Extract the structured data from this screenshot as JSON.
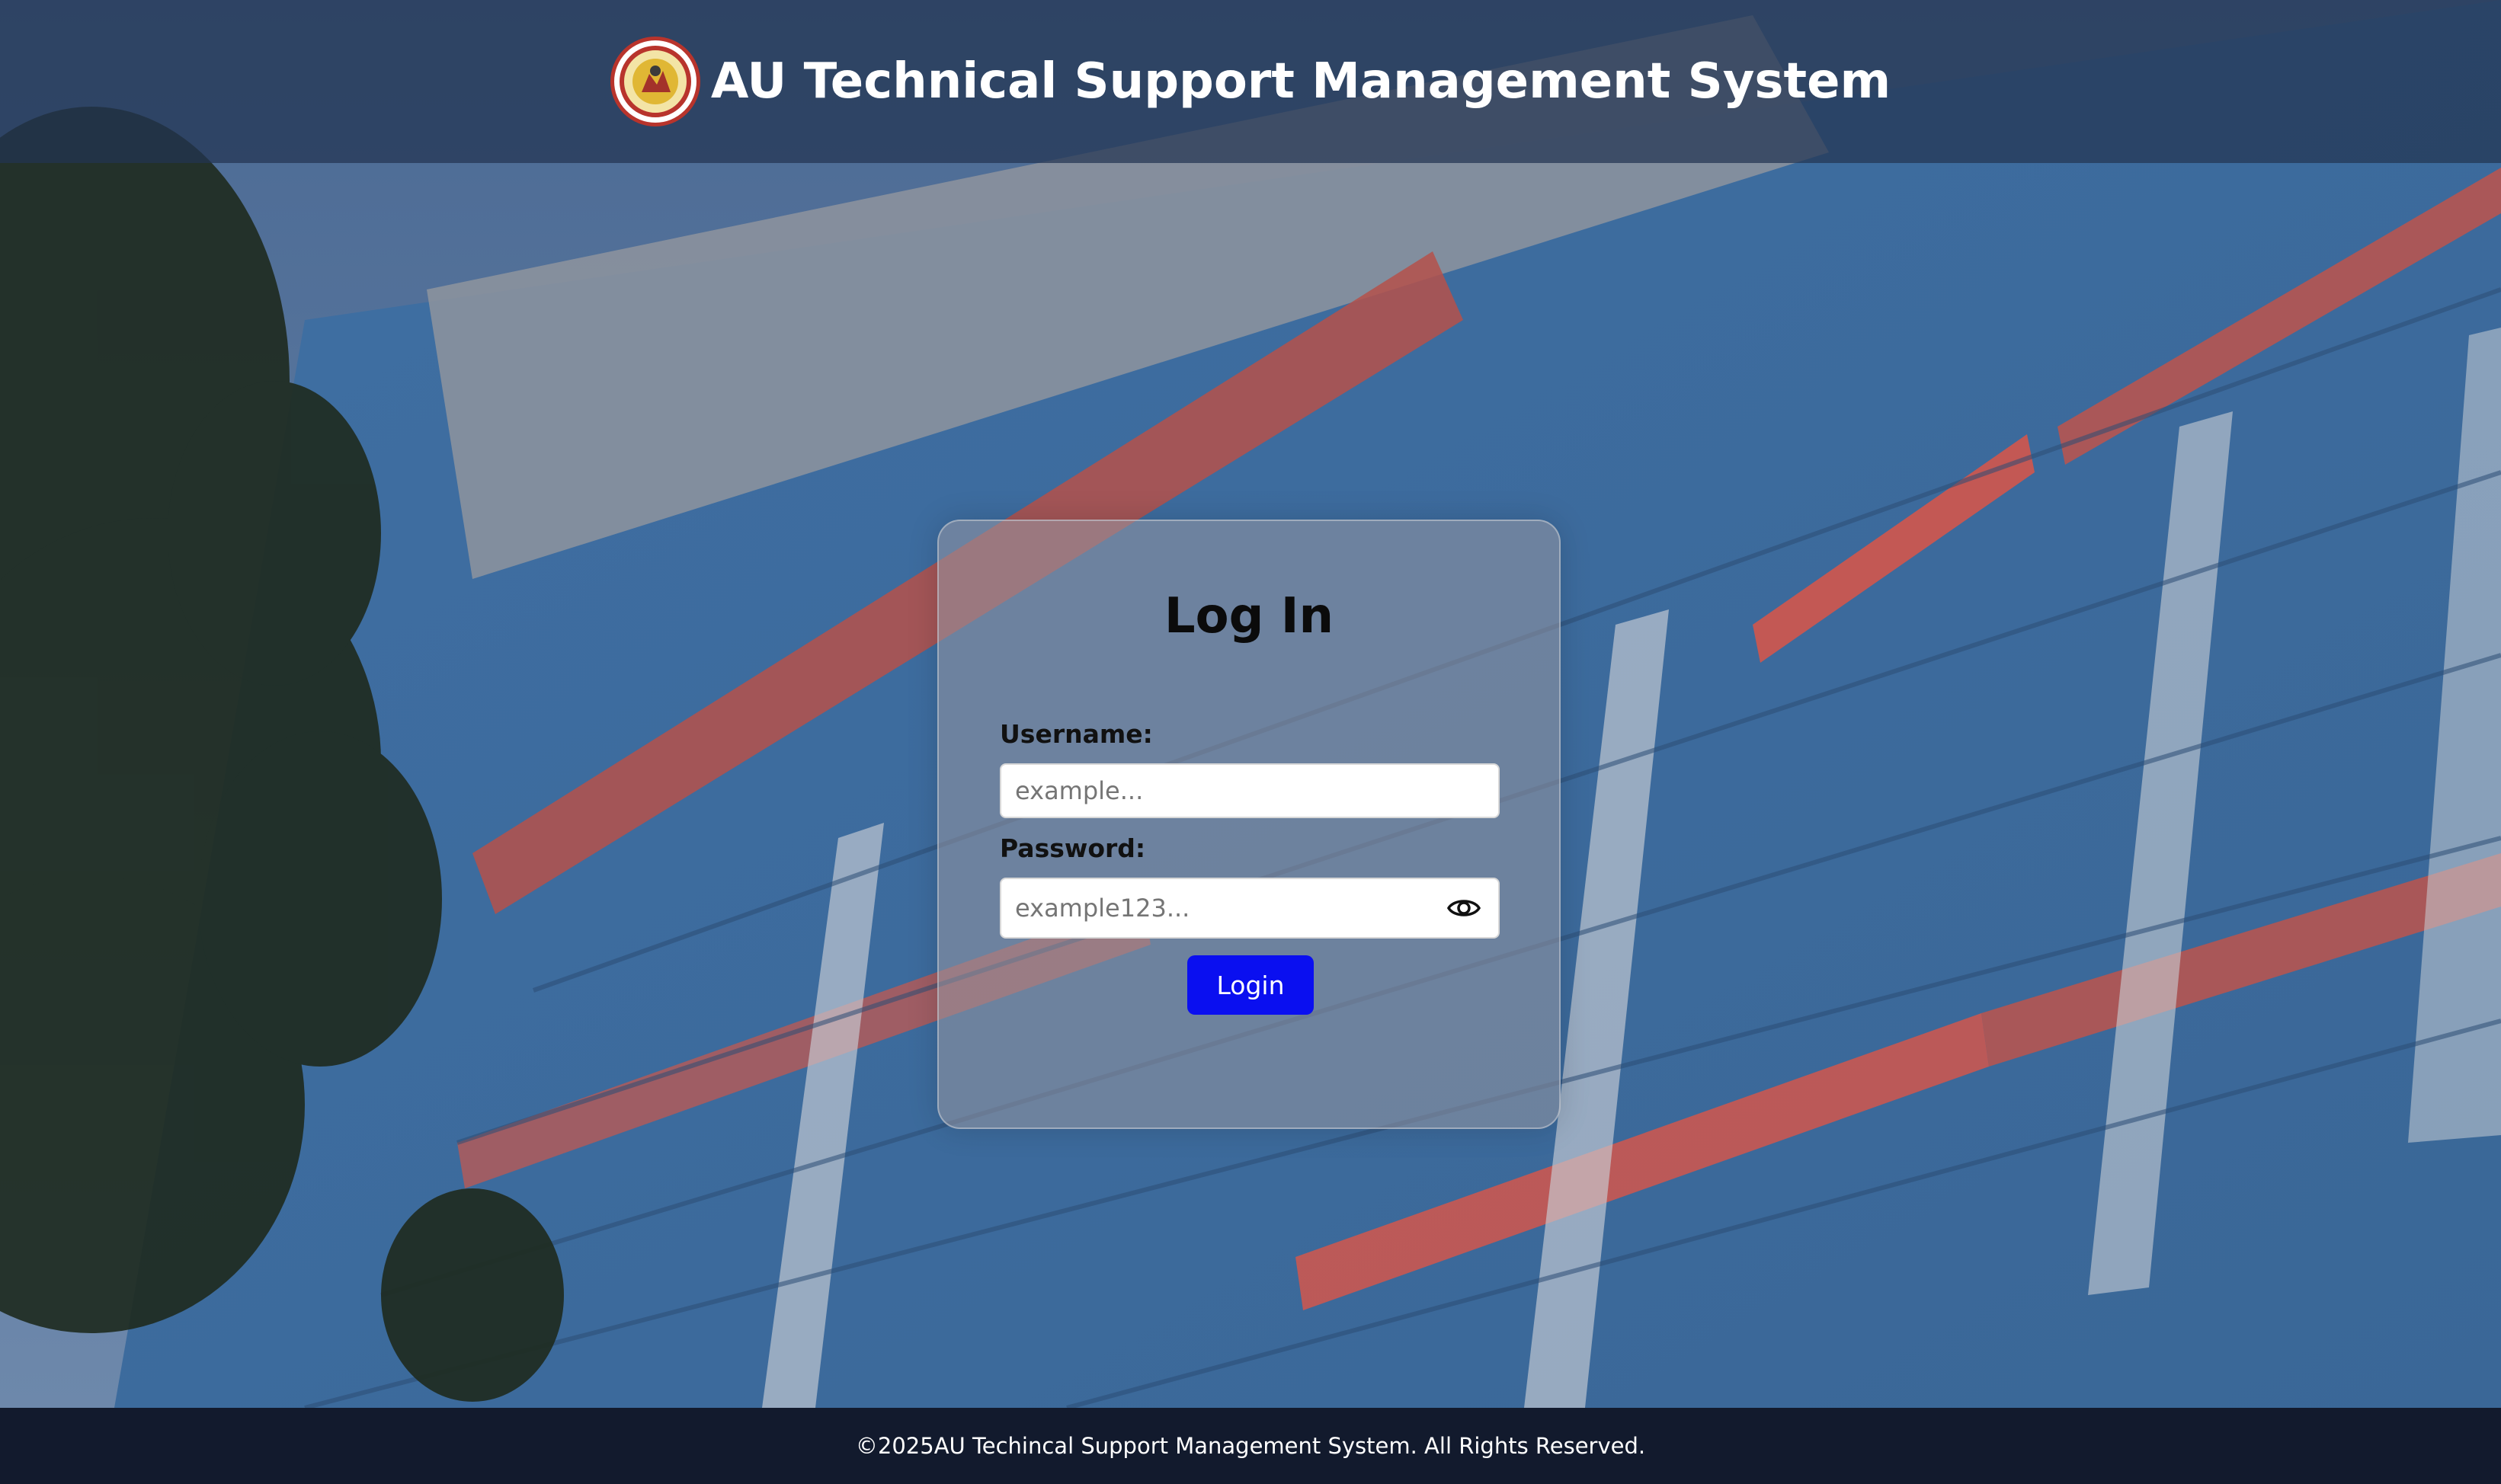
{
  "header": {
    "title": "AU Technical Support Management System",
    "logo_icon": "university-seal-icon"
  },
  "login": {
    "title": "Log In",
    "username_label": "Username:",
    "username_placeholder": "example...",
    "password_label": "Password:",
    "password_placeholder": "example123...",
    "show_password_icon": "eye-icon",
    "submit_label": "Login"
  },
  "footer": {
    "text": "©2025AU Techincal Support Management System. All Rights Reserved."
  },
  "colors": {
    "header_bg": "#233452",
    "footer_bg": "#121a2d",
    "button_bg": "#0a0ff0",
    "logo_ring": "#b8342c"
  }
}
